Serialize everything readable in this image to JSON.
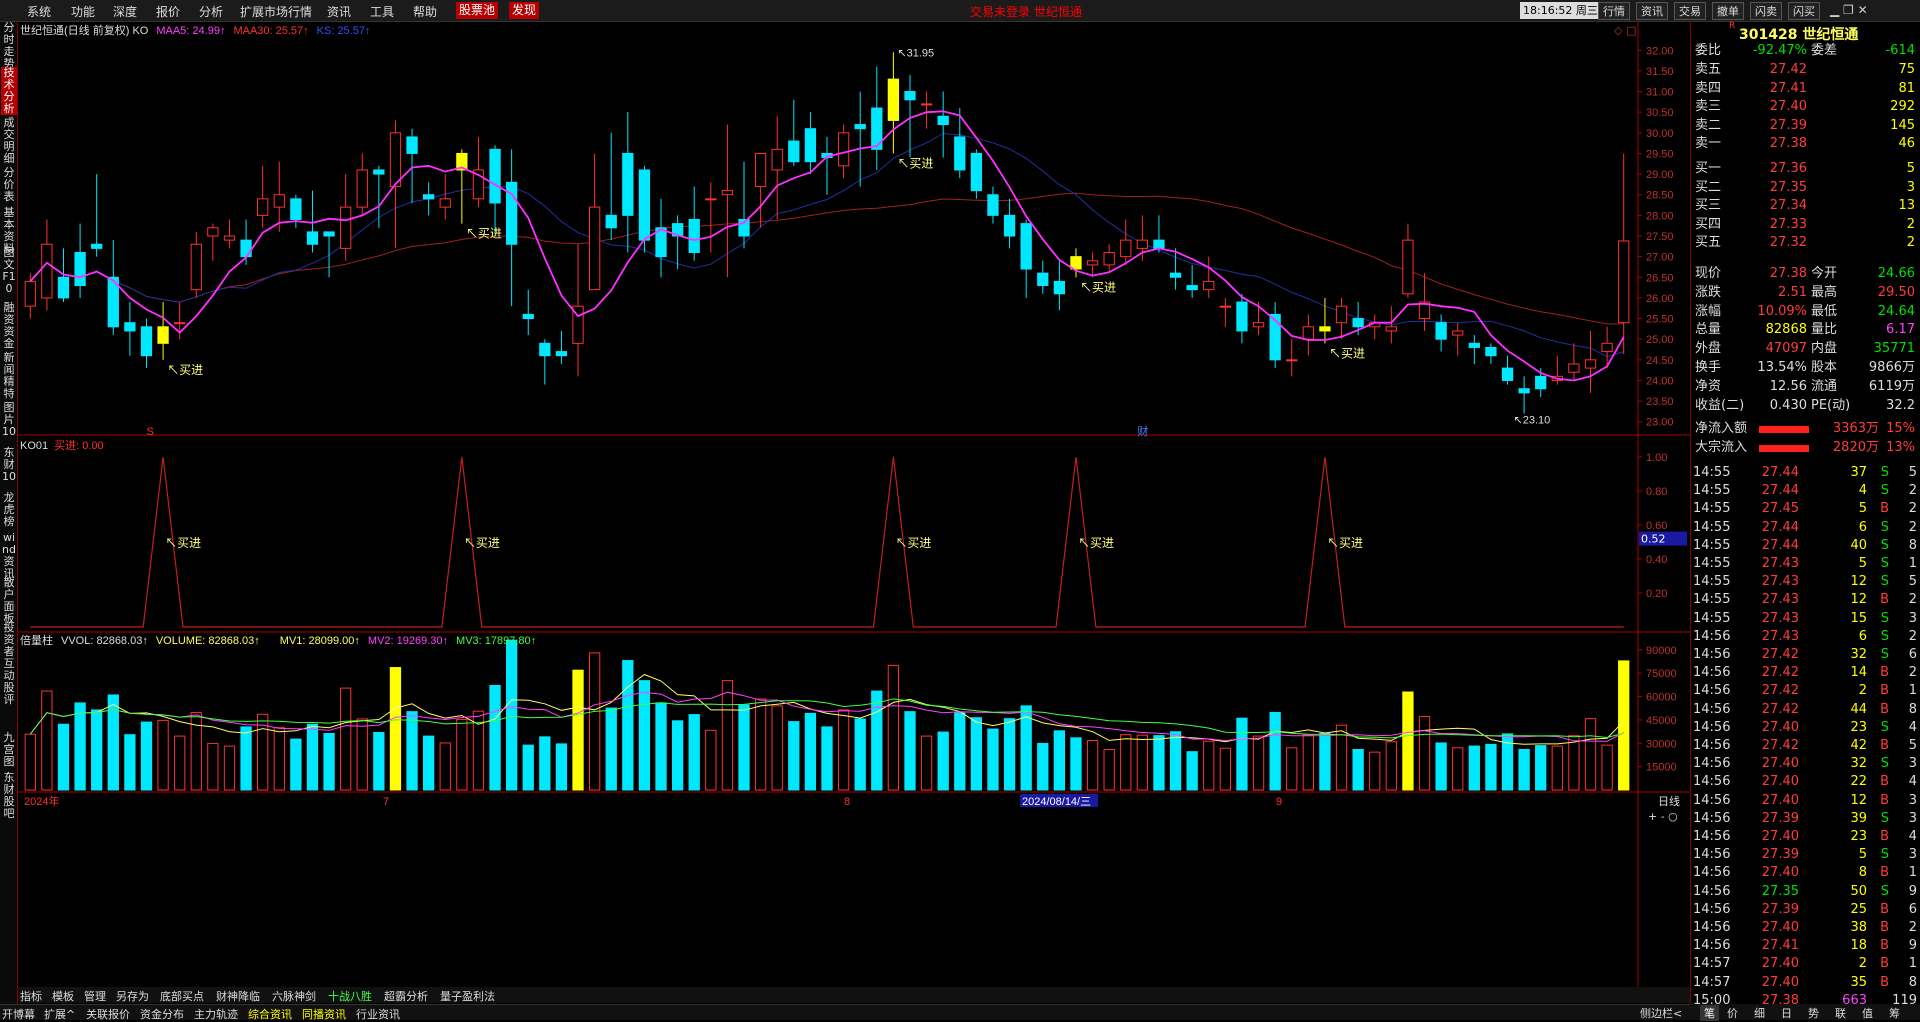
{
  "menu": {
    "items": [
      "系统",
      "功能",
      "深度",
      "报价",
      "分析",
      "扩展市场行情",
      "资讯",
      "工具",
      "帮助"
    ],
    "hot_items": [
      "股票池",
      "发现"
    ],
    "center_notice": "交易未登录   世纪恒通",
    "clock": "18:16:52 周三",
    "right_buttons": [
      "行情",
      "资讯",
      "交易",
      "撤单",
      "闪卖",
      "闪买"
    ]
  },
  "left_tabs": [
    "分时走势",
    "技术分析",
    "成交明细",
    "分价表",
    "基本资料",
    "图文F10",
    "融资资金",
    "新闻精特",
    "图片10",
    "东财10",
    "龙虎榜",
    "wind资讯",
    "散户面板",
    "投资者互动",
    "股评",
    "九宫图",
    "东财股吧"
  ],
  "left_tab_active": 1,
  "main_chart": {
    "title": "世纪恒通(日线 前复权) KO",
    "ma5_label": "MAA5: 24.99↑",
    "ma30_label": "MAA30: 25.57↑",
    "ks_label": "KS: 25.57↑",
    "high_label": "31.95",
    "low_label": "23.10",
    "buy_label": "买进",
    "marker_s": "S",
    "marker_cai": "财",
    "y_ticks": [
      "32.00",
      "31.50",
      "31.00",
      "30.50",
      "30.00",
      "29.50",
      "29.00",
      "28.50",
      "28.00",
      "27.50",
      "27.00",
      "26.50",
      "26.00",
      "25.50",
      "25.00",
      "24.50",
      "24.00",
      "23.50",
      "23.00"
    ]
  },
  "ko_panel": {
    "title": "KO01",
    "signal_label": "买进: 0.00",
    "y_ticks": [
      "1.00",
      "0.80",
      "0.60",
      "0.40",
      "0.20"
    ],
    "current_value": "0.52",
    "buy_label": "买进"
  },
  "vol_panel": {
    "title": "倍量柱",
    "vvol_label": "VVOL: 82868.03↑",
    "volume_label": "VOLUME: 82868.03↑",
    "mv1_label": "MV1: 28099.00↑",
    "mv2_label": "MV2: 19269.30↑",
    "mv3_label": "MV3: 17897.80↑",
    "y_ticks": [
      "90000",
      "75000",
      "60000",
      "45000",
      "30000",
      "15000"
    ]
  },
  "x_axis": {
    "labels": [
      "2024年",
      "7",
      "8",
      "2024/08/14/三",
      "9"
    ],
    "right_label": "日线",
    "controls": [
      "+",
      "-",
      "○"
    ]
  },
  "chart_data": {
    "type": "candlestick",
    "title": "世纪恒通(日线 前复权) KO",
    "ylim": [
      22.8,
      32.2
    ],
    "candles": [
      [
        25.8,
        26.4,
        26.6,
        25.5
      ],
      [
        26.0,
        27.3,
        27.9,
        25.7
      ],
      [
        26.5,
        26.0,
        27.2,
        25.9
      ],
      [
        27.1,
        26.3,
        27.8,
        26.0
      ],
      [
        27.3,
        27.2,
        29.0,
        27.0
      ],
      [
        26.5,
        25.3,
        27.4,
        25.1
      ],
      [
        25.4,
        25.2,
        25.9,
        24.6
      ],
      [
        25.3,
        24.6,
        25.5,
        24.3
      ],
      [
        24.9,
        25.3,
        25.9,
        24.5
      ],
      [
        25.4,
        25.4,
        25.9,
        25.0
      ],
      [
        26.2,
        27.3,
        27.6,
        26.0
      ],
      [
        27.5,
        27.7,
        27.8,
        26.9
      ],
      [
        27.4,
        27.5,
        27.9,
        27.2
      ],
      [
        27.4,
        27.0,
        27.9,
        26.8
      ],
      [
        28.0,
        28.4,
        29.2,
        27.7
      ],
      [
        28.2,
        28.5,
        29.3,
        27.6
      ],
      [
        28.4,
        27.9,
        28.5,
        27.7
      ],
      [
        27.6,
        27.3,
        28.6,
        27.1
      ],
      [
        27.6,
        27.5,
        27.6,
        26.5
      ],
      [
        27.2,
        28.2,
        29.0,
        26.9
      ],
      [
        28.2,
        29.1,
        29.5,
        28.0
      ],
      [
        29.1,
        29.0,
        29.2,
        27.7
      ],
      [
        28.7,
        30.0,
        30.3,
        27.2
      ],
      [
        29.9,
        29.5,
        30.1,
        28.3
      ],
      [
        28.5,
        28.4,
        28.8,
        28.0
      ],
      [
        28.2,
        28.4,
        29.0,
        27.9
      ],
      [
        29.1,
        29.5,
        29.6,
        27.8
      ],
      [
        28.4,
        29.1,
        29.9,
        28.2
      ],
      [
        29.6,
        28.3,
        29.7,
        27.6
      ],
      [
        28.8,
        27.3,
        29.6,
        25.8
      ],
      [
        25.6,
        25.5,
        26.2,
        25.1
      ],
      [
        24.9,
        24.6,
        25.0,
        23.9
      ],
      [
        24.7,
        24.6,
        25.2,
        24.4
      ],
      [
        24.9,
        25.8,
        27.3,
        24.1
      ],
      [
        26.2,
        28.2,
        29.5,
        26.2
      ],
      [
        28.0,
        27.7,
        30.0,
        27.4
      ],
      [
        29.5,
        28.0,
        30.5,
        27.1
      ],
      [
        29.1,
        27.4,
        29.2,
        27.1
      ],
      [
        27.7,
        27.0,
        28.4,
        26.5
      ],
      [
        27.8,
        27.5,
        28.0,
        26.7
      ],
      [
        27.9,
        27.1,
        28.7,
        26.9
      ],
      [
        28.4,
        28.4,
        28.8,
        27.1
      ],
      [
        28.5,
        28.6,
        30.2,
        26.5
      ],
      [
        27.9,
        27.5,
        29.3,
        27.2
      ],
      [
        28.7,
        29.5,
        29.5,
        27.7
      ],
      [
        29.1,
        29.6,
        30.4,
        27.9
      ],
      [
        29.8,
        29.3,
        30.8,
        29.2
      ],
      [
        30.1,
        29.3,
        30.5,
        29.0
      ],
      [
        29.5,
        29.4,
        29.9,
        28.5
      ],
      [
        29.2,
        30.0,
        30.2,
        28.9
      ],
      [
        30.2,
        30.1,
        31.0,
        28.7
      ],
      [
        30.6,
        29.6,
        31.6,
        29.1
      ],
      [
        30.3,
        31.3,
        31.95,
        29.5
      ],
      [
        31.0,
        30.8,
        31.4,
        29.4
      ],
      [
        30.7,
        30.7,
        31.0,
        30.1
      ],
      [
        30.4,
        30.2,
        31.0,
        29.4
      ],
      [
        29.9,
        29.1,
        30.6,
        28.9
      ],
      [
        29.5,
        28.6,
        29.6,
        28.4
      ],
      [
        28.5,
        28.0,
        28.7,
        27.8
      ],
      [
        28.0,
        27.5,
        28.4,
        27.2
      ],
      [
        27.8,
        26.7,
        27.9,
        26.0
      ],
      [
        26.6,
        26.3,
        26.9,
        26.1
      ],
      [
        26.4,
        26.1,
        26.9,
        25.7
      ],
      [
        27.0,
        26.7,
        27.2,
        26.5
      ],
      [
        26.8,
        26.9,
        27.1,
        26.5
      ],
      [
        26.8,
        27.1,
        27.3,
        26.6
      ],
      [
        27.0,
        27.4,
        27.9,
        26.8
      ],
      [
        27.2,
        27.4,
        28.0,
        26.9
      ],
      [
        27.4,
        27.2,
        28.0,
        27.1
      ],
      [
        26.6,
        26.5,
        27.2,
        26.2
      ],
      [
        26.3,
        26.2,
        26.8,
        26.0
      ],
      [
        26.2,
        26.4,
        27.0,
        26.0
      ],
      [
        25.8,
        25.8,
        26.0,
        25.3
      ],
      [
        25.9,
        25.2,
        26.1,
        24.9
      ],
      [
        25.3,
        25.4,
        25.9,
        25.1
      ],
      [
        25.6,
        24.5,
        25.9,
        24.3
      ],
      [
        24.5,
        24.5,
        25.0,
        24.1
      ],
      [
        25.0,
        25.3,
        25.6,
        24.6
      ],
      [
        25.3,
        25.2,
        26.0,
        24.9
      ],
      [
        25.4,
        25.8,
        26.0,
        25.0
      ],
      [
        25.5,
        25.3,
        25.9,
        25.1
      ],
      [
        25.3,
        25.4,
        25.6,
        25.0
      ],
      [
        25.2,
        25.3,
        25.8,
        24.9
      ],
      [
        26.1,
        27.4,
        27.8,
        26.0
      ],
      [
        25.5,
        25.9,
        26.6,
        25.2
      ],
      [
        25.4,
        25.0,
        25.6,
        24.7
      ],
      [
        25.1,
        25.2,
        25.4,
        24.6
      ],
      [
        24.9,
        24.8,
        25.1,
        24.4
      ],
      [
        24.8,
        24.6,
        24.9,
        24.4
      ],
      [
        24.3,
        24.0,
        24.6,
        23.9
      ],
      [
        23.8,
        23.7,
        24.1,
        23.2
      ],
      [
        24.1,
        23.8,
        24.3,
        23.6
      ],
      [
        24.0,
        24.1,
        24.6,
        23.9
      ],
      [
        24.2,
        24.4,
        24.9,
        24.0
      ],
      [
        24.3,
        24.5,
        25.2,
        23.7
      ],
      [
        24.7,
        24.9,
        25.3,
        24.3
      ],
      [
        25.4,
        27.38,
        29.5,
        24.64
      ]
    ],
    "buy_signals": [
      8,
      26,
      52,
      63,
      78
    ]
  },
  "quote": {
    "code_name": "301428 世纪恒通",
    "r_mark": "R",
    "weibi_label": "委比",
    "weibi": "-92.47%",
    "weicha_label": "委差",
    "weicha": "-614",
    "asks": [
      [
        "卖五",
        "27.42",
        "75"
      ],
      [
        "卖四",
        "27.41",
        "81"
      ],
      [
        "卖三",
        "27.40",
        "292"
      ],
      [
        "卖二",
        "27.39",
        "145"
      ],
      [
        "卖一",
        "27.38",
        "46"
      ]
    ],
    "bids": [
      [
        "买一",
        "27.36",
        "5"
      ],
      [
        "买二",
        "27.35",
        "3"
      ],
      [
        "买三",
        "27.34",
        "13"
      ],
      [
        "买四",
        "27.33",
        "2"
      ],
      [
        "买五",
        "27.32",
        "2"
      ]
    ],
    "stats": [
      [
        "现价",
        "27.38",
        "今开",
        "24.66"
      ],
      [
        "涨跌",
        "2.51",
        "最高",
        "29.50"
      ],
      [
        "涨幅",
        "10.09%",
        "最低",
        "24.64"
      ],
      [
        "总量",
        "82868",
        "量比",
        "6.17"
      ],
      [
        "外盘",
        "47097",
        "内盘",
        "35771"
      ],
      [
        "换手",
        "13.54%",
        "股本",
        "9866万"
      ],
      [
        "净资",
        "12.56",
        "流通",
        "6119万"
      ],
      [
        "收益(二)",
        "0.430",
        "PE(动)",
        "32.2"
      ]
    ],
    "flows": [
      [
        "净流入额",
        "3363万",
        "15%"
      ],
      [
        "大宗流入",
        "2820万",
        "13%"
      ]
    ],
    "ticks": [
      [
        "14:55",
        "27.44",
        "37",
        "S",
        "5"
      ],
      [
        "14:55",
        "27.44",
        "4",
        "S",
        "2"
      ],
      [
        "14:55",
        "27.45",
        "5",
        "B",
        "2"
      ],
      [
        "14:55",
        "27.44",
        "6",
        "S",
        "2"
      ],
      [
        "14:55",
        "27.44",
        "40",
        "S",
        "8"
      ],
      [
        "14:55",
        "27.43",
        "5",
        "S",
        "1"
      ],
      [
        "14:55",
        "27.43",
        "12",
        "S",
        "5"
      ],
      [
        "14:55",
        "27.43",
        "12",
        "B",
        "2"
      ],
      [
        "14:55",
        "27.43",
        "15",
        "S",
        "3"
      ],
      [
        "14:56",
        "27.43",
        "6",
        "S",
        "2"
      ],
      [
        "14:56",
        "27.42",
        "32",
        "S",
        "6"
      ],
      [
        "14:56",
        "27.42",
        "14",
        "B",
        "2"
      ],
      [
        "14:56",
        "27.42",
        "2",
        "B",
        "1"
      ],
      [
        "14:56",
        "27.42",
        "44",
        "B",
        "8"
      ],
      [
        "14:56",
        "27.40",
        "23",
        "S",
        "4"
      ],
      [
        "14:56",
        "27.42",
        "42",
        "B",
        "5"
      ],
      [
        "14:56",
        "27.40",
        "32",
        "S",
        "3"
      ],
      [
        "14:56",
        "27.40",
        "22",
        "B",
        "4"
      ],
      [
        "14:56",
        "27.40",
        "12",
        "B",
        "3"
      ],
      [
        "14:56",
        "27.39",
        "39",
        "S",
        "3"
      ],
      [
        "14:56",
        "27.40",
        "23",
        "B",
        "4"
      ],
      [
        "14:56",
        "27.39",
        "5",
        "S",
        "3"
      ],
      [
        "14:56",
        "27.40",
        "8",
        "B",
        "1"
      ],
      [
        "14:56",
        "27.35",
        "50",
        "S",
        "9"
      ],
      [
        "14:56",
        "27.39",
        "25",
        "B",
        "6"
      ],
      [
        "14:56",
        "27.40",
        "38",
        "B",
        "2"
      ],
      [
        "14:56",
        "27.41",
        "18",
        "B",
        "9"
      ],
      [
        "14:57",
        "27.40",
        "2",
        "B",
        "1"
      ],
      [
        "14:57",
        "27.40",
        "35",
        "B",
        "8"
      ],
      [
        "15:00",
        "27.38",
        "663",
        "",
        "119"
      ]
    ]
  },
  "bottom_tabs": [
    "指标",
    "模板",
    "管理",
    "另存为",
    "底部买点",
    "财神降临",
    "六脉神剑",
    "十战八胜",
    "超霸分析",
    "量子盈利法"
  ],
  "status_tabs": [
    "开博幕",
    "扩展^",
    "关联报价",
    "资金分布",
    "主力轨迹",
    "综合资讯",
    "同播资讯",
    "行业资讯"
  ],
  "rp_bottom": [
    "侧边栏<",
    "笔",
    "价",
    "细",
    "日",
    "势",
    "联",
    "值",
    "筹"
  ]
}
